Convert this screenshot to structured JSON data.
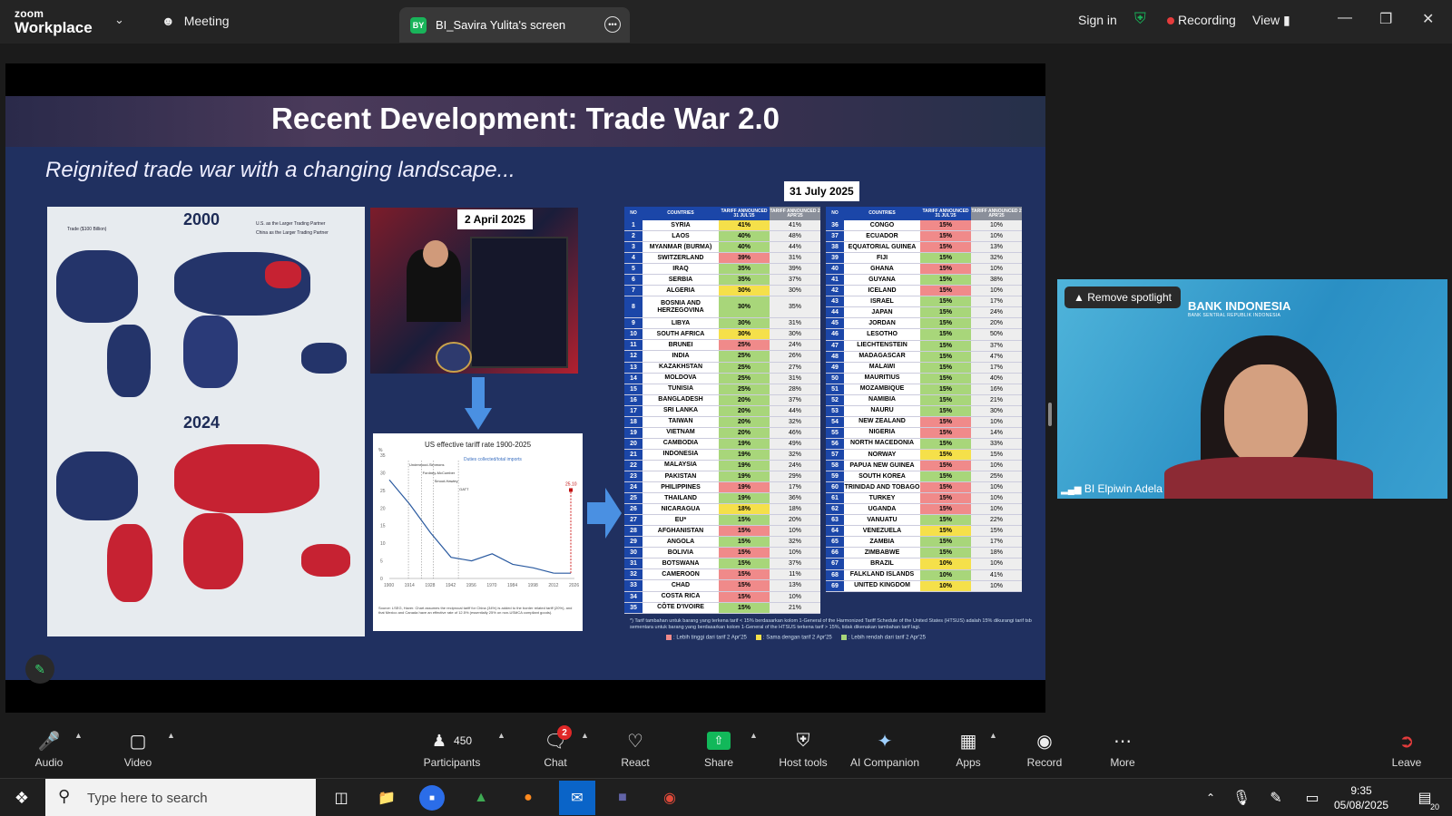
{
  "titlebar": {
    "logo_top": "zoom",
    "logo_bottom": "Workplace",
    "meeting_label": "Meeting",
    "tab_avatar": "BY",
    "tab_label": "BI_Savira Yulita's screen",
    "sign_in": "Sign in",
    "recording": "Recording",
    "view": "View"
  },
  "slide": {
    "title": "Recent Development: Trade War 2.0",
    "subtitle": "Reignited trade war with a changing landscape...",
    "map_year_top": "2000",
    "map_year_bottom": "2024",
    "map_legend_trade": "Trade ($100 Billion)",
    "map_legend_us": "U.S. as the Larger Trading Partner",
    "map_legend_china": "China as the Larger Trading Partner",
    "photo_label": "2 April 2025",
    "chart_title": "US effective tariff rate 1900-2025",
    "chart_series": "Duties collected/total imports",
    "chart_source": "Source: LSEG, Haver. Chart assumes the reciprocal tariff for China (34%) is added to the border related tariff (20%), and that Mexico and Canada have an effective rate of 12.5% (essentially 25% on non-USMCA compliant goods).",
    "table_date": "31 July 2025",
    "col_no": "NO",
    "col_country": "COUNTRIES",
    "col_announced": "TARIFF ANNOUNCED 31 JUL'25",
    "col_prev": "TARIFF ANNOUNCED 2 APR'25",
    "footnote": "*) Tarif tambahan untuk barang yang terkena tarif < 15% berdasarkan kolom 1-General of the Harmonized Tariff Schedule of the United States (HTSUS) adalah 15% dikurangi tarif tsb sementara untuk barang yang berdasarkan kolom 1-General of the HTSUS terkena tarif > 15%, tidak dikenakan tambahan tarif lagi.",
    "legend_higher": ": Lebih tinggi dari tarif 2 Apr'25",
    "legend_same": ": Sama dengan tarif 2 Apr'25",
    "legend_lower": ": Lebih rendah dari tarif 2 Apr'25"
  },
  "chart_data": {
    "type": "line",
    "title": "US effective tariff rate 1900-2025",
    "xlabel": "",
    "ylabel": "%",
    "x": [
      1900,
      1914,
      1928,
      1942,
      1956,
      1970,
      1984,
      1998,
      2012,
      2026
    ],
    "ylim": [
      0,
      35
    ],
    "series": [
      {
        "name": "Duties collected/total imports",
        "values": [
          28,
          21,
          13,
          6,
          5,
          7,
          4,
          3,
          1.5,
          25.1
        ]
      }
    ],
    "annotations": [
      "Underwood-Simmons",
      "Fordney-McCumber",
      "Smoot-Hawley",
      "GATT",
      "25.10"
    ]
  },
  "table_left": [
    [
      "1",
      "SYRIA",
      "41%",
      "41%",
      "s"
    ],
    [
      "2",
      "LAOS",
      "40%",
      "48%",
      "l"
    ],
    [
      "3",
      "MYANMAR (BURMA)",
      "40%",
      "44%",
      "l"
    ],
    [
      "4",
      "SWITZERLAND",
      "39%",
      "31%",
      "h"
    ],
    [
      "5",
      "IRAQ",
      "35%",
      "39%",
      "l"
    ],
    [
      "6",
      "SERBIA",
      "35%",
      "37%",
      "l"
    ],
    [
      "7",
      "ALGERIA",
      "30%",
      "30%",
      "s"
    ],
    [
      "8",
      "BOSNIA AND HERZEGOVINA",
      "30%",
      "35%",
      "l"
    ],
    [
      "9",
      "LIBYA",
      "30%",
      "31%",
      "l"
    ],
    [
      "10",
      "SOUTH AFRICA",
      "30%",
      "30%",
      "s"
    ],
    [
      "11",
      "BRUNEI",
      "25%",
      "24%",
      "h"
    ],
    [
      "12",
      "INDIA",
      "25%",
      "26%",
      "l"
    ],
    [
      "13",
      "KAZAKHSTAN",
      "25%",
      "27%",
      "l"
    ],
    [
      "14",
      "MOLDOVA",
      "25%",
      "31%",
      "l"
    ],
    [
      "15",
      "TUNISIA",
      "25%",
      "28%",
      "l"
    ],
    [
      "16",
      "BANGLADESH",
      "20%",
      "37%",
      "l"
    ],
    [
      "17",
      "SRI LANKA",
      "20%",
      "44%",
      "l"
    ],
    [
      "18",
      "TAIWAN",
      "20%",
      "32%",
      "l"
    ],
    [
      "19",
      "VIETNAM",
      "20%",
      "46%",
      "l"
    ],
    [
      "20",
      "CAMBODIA",
      "19%",
      "49%",
      "l"
    ],
    [
      "21",
      "INDONESIA",
      "19%",
      "32%",
      "l"
    ],
    [
      "22",
      "MALAYSIA",
      "19%",
      "24%",
      "l"
    ],
    [
      "23",
      "PAKISTAN",
      "19%",
      "29%",
      "l"
    ],
    [
      "24",
      "PHILIPPINES",
      "19%",
      "17%",
      "h"
    ],
    [
      "25",
      "THAILAND",
      "19%",
      "36%",
      "l"
    ],
    [
      "26",
      "NICARAGUA",
      "18%",
      "18%",
      "s"
    ],
    [
      "27",
      "EU*",
      "15%",
      "20%",
      "l"
    ],
    [
      "28",
      "AFGHANISTAN",
      "15%",
      "10%",
      "h"
    ],
    [
      "29",
      "ANGOLA",
      "15%",
      "32%",
      "l"
    ],
    [
      "30",
      "BOLIVIA",
      "15%",
      "10%",
      "h"
    ],
    [
      "31",
      "BOTSWANA",
      "15%",
      "37%",
      "l"
    ],
    [
      "32",
      "CAMEROON",
      "15%",
      "11%",
      "h"
    ],
    [
      "33",
      "CHAD",
      "15%",
      "13%",
      "h"
    ],
    [
      "34",
      "COSTA RICA",
      "15%",
      "10%",
      "h"
    ],
    [
      "35",
      "CÔTE D'IVOIRE",
      "15%",
      "21%",
      "l"
    ]
  ],
  "table_right": [
    [
      "36",
      "CONGO",
      "15%",
      "10%",
      "h"
    ],
    [
      "37",
      "ECUADOR",
      "15%",
      "10%",
      "h"
    ],
    [
      "38",
      "EQUATORIAL GUINEA",
      "15%",
      "13%",
      "h"
    ],
    [
      "39",
      "FIJI",
      "15%",
      "32%",
      "l"
    ],
    [
      "40",
      "GHANA",
      "15%",
      "10%",
      "h"
    ],
    [
      "41",
      "GUYANA",
      "15%",
      "38%",
      "l"
    ],
    [
      "42",
      "ICELAND",
      "15%",
      "10%",
      "h"
    ],
    [
      "43",
      "ISRAEL",
      "15%",
      "17%",
      "l"
    ],
    [
      "44",
      "JAPAN",
      "15%",
      "24%",
      "l"
    ],
    [
      "45",
      "JORDAN",
      "15%",
      "20%",
      "l"
    ],
    [
      "46",
      "LESOTHO",
      "15%",
      "50%",
      "l"
    ],
    [
      "47",
      "LIECHTENSTEIN",
      "15%",
      "37%",
      "l"
    ],
    [
      "48",
      "MADAGASCAR",
      "15%",
      "47%",
      "l"
    ],
    [
      "49",
      "MALAWI",
      "15%",
      "17%",
      "l"
    ],
    [
      "50",
      "MAURITIUS",
      "15%",
      "40%",
      "l"
    ],
    [
      "51",
      "MOZAMBIQUE",
      "15%",
      "16%",
      "l"
    ],
    [
      "52",
      "NAMIBIA",
      "15%",
      "21%",
      "l"
    ],
    [
      "53",
      "NAURU",
      "15%",
      "30%",
      "l"
    ],
    [
      "54",
      "NEW ZEALAND",
      "15%",
      "10%",
      "h"
    ],
    [
      "55",
      "NIGERIA",
      "15%",
      "14%",
      "h"
    ],
    [
      "56",
      "NORTH MACEDONIA",
      "15%",
      "33%",
      "l"
    ],
    [
      "57",
      "NORWAY",
      "15%",
      "15%",
      "s"
    ],
    [
      "58",
      "PAPUA NEW GUINEA",
      "15%",
      "10%",
      "h"
    ],
    [
      "59",
      "SOUTH KOREA",
      "15%",
      "25%",
      "l"
    ],
    [
      "60",
      "TRINIDAD AND TOBAGO",
      "15%",
      "10%",
      "h"
    ],
    [
      "61",
      "TURKEY",
      "15%",
      "10%",
      "h"
    ],
    [
      "62",
      "UGANDA",
      "15%",
      "10%",
      "h"
    ],
    [
      "63",
      "VANUATU",
      "15%",
      "22%",
      "l"
    ],
    [
      "64",
      "VENEZUELA",
      "15%",
      "15%",
      "s"
    ],
    [
      "65",
      "ZAMBIA",
      "15%",
      "17%",
      "l"
    ],
    [
      "66",
      "ZIMBABWE",
      "15%",
      "18%",
      "l"
    ],
    [
      "67",
      "BRAZIL",
      "10%",
      "10%",
      "s"
    ],
    [
      "68",
      "FALKLAND ISLANDS",
      "10%",
      "41%",
      "l"
    ],
    [
      "69",
      "UNITED KINGDOM",
      "10%",
      "10%",
      "s"
    ]
  ],
  "colors": {
    "higher": "#f08a8a",
    "same": "#f5e04a",
    "lower": "#a8d67a",
    "accent": "#12b85a",
    "record": "#e53c3c"
  },
  "video": {
    "spotlight_btn": "Remove spotlight",
    "org_logo": "BANK INDONESIA",
    "org_sub": "BANK SENTRAL REPUBLIK INDONESIA",
    "participant_name": "BI Elpiwin Adela"
  },
  "toolbar": {
    "audio": "Audio",
    "video": "Video",
    "participants": "Participants",
    "participants_count": "450",
    "chat": "Chat",
    "chat_badge": "2",
    "react": "React",
    "share": "Share",
    "host_tools": "Host tools",
    "ai_companion": "AI Companion",
    "apps": "Apps",
    "record": "Record",
    "more": "More",
    "leave": "Leave"
  },
  "taskbar": {
    "search_placeholder": "Type here to search",
    "time": "9:35",
    "date": "05/08/2025",
    "notif_count": "20"
  }
}
